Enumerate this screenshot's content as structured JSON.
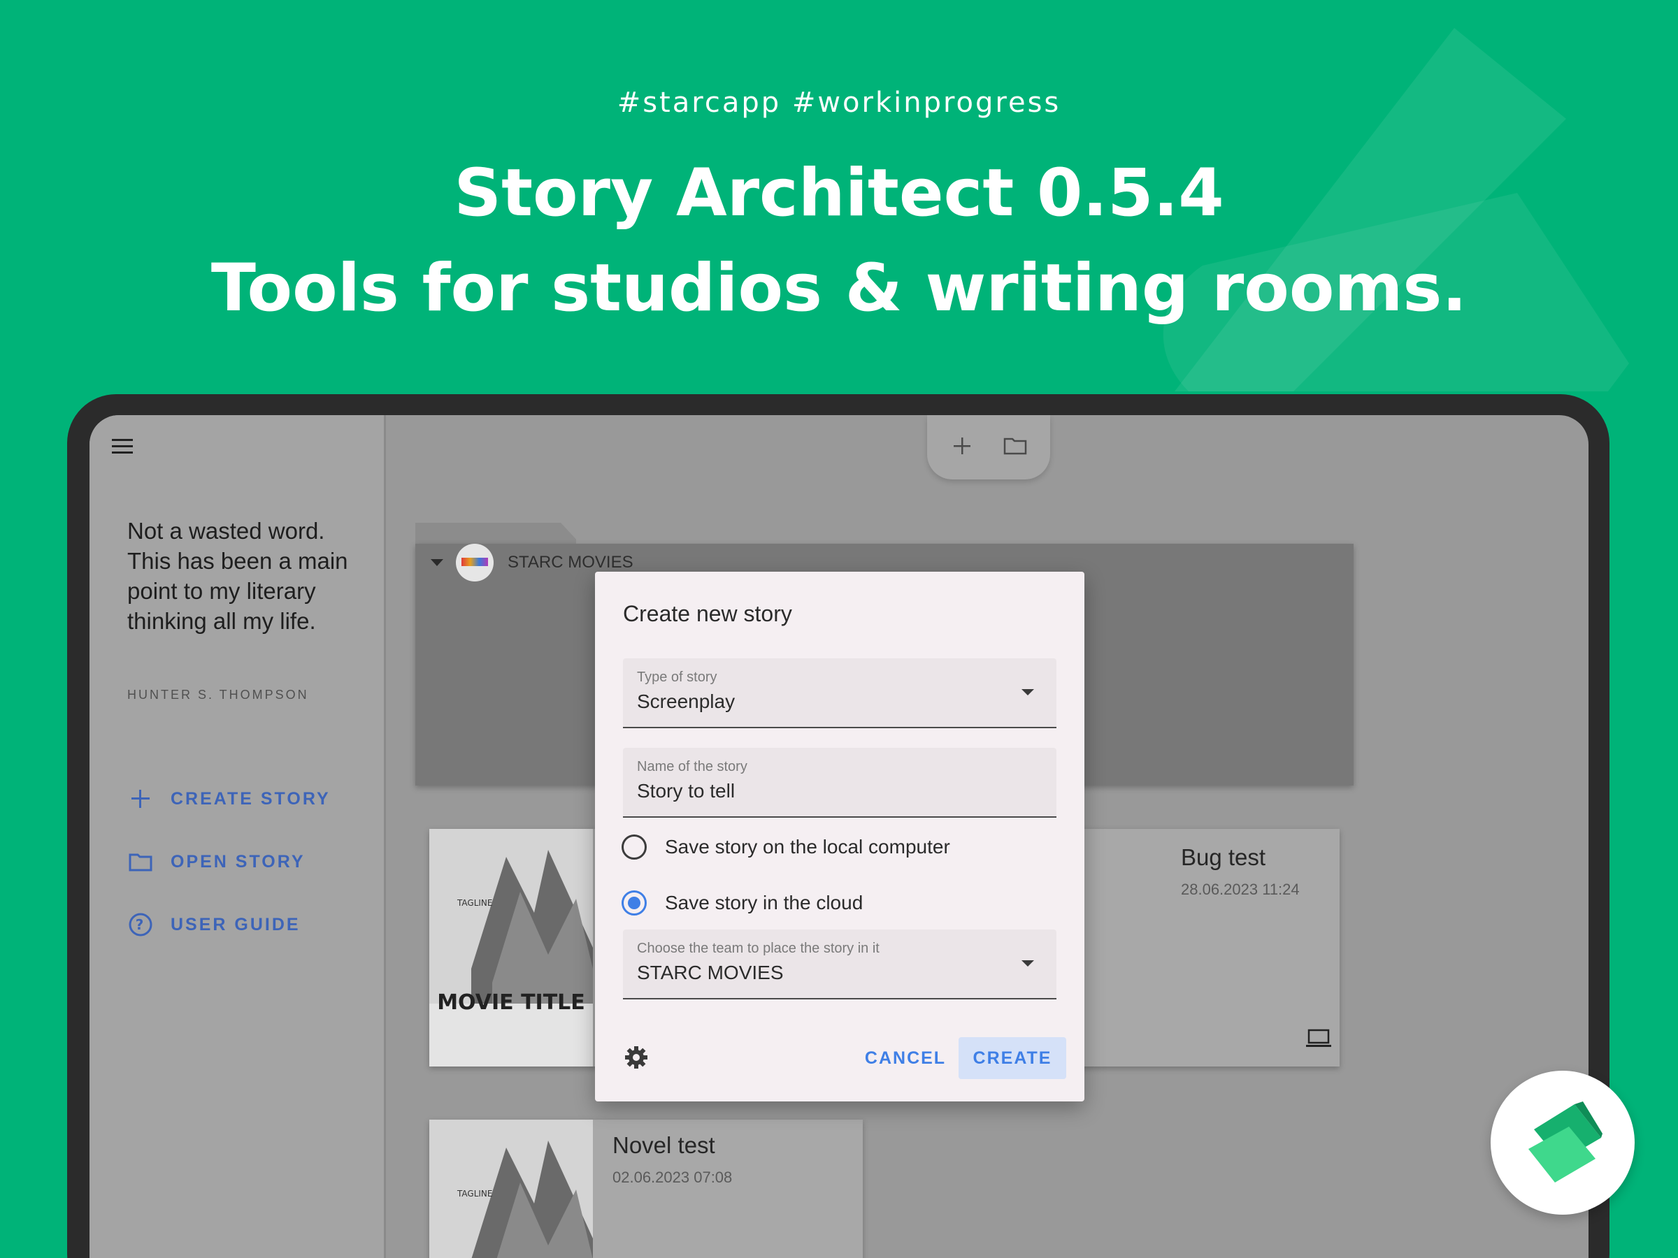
{
  "banner": {
    "hashtags": "#starcapp  #workinprogress",
    "headline_line1": "Story Architect 0.5.4",
    "headline_line2": "Tools for studios & writing rooms."
  },
  "sidebar": {
    "quote": "Not a wasted word. This has been a main point to my literary thinking all my life.",
    "quote_author": "HUNTER S. THOMPSON",
    "actions": [
      {
        "label": "CREATE STORY",
        "icon": "plus-icon"
      },
      {
        "label": "OPEN STORY",
        "icon": "folder-icon"
      },
      {
        "label": "USER GUIDE",
        "icon": "help-circle-icon"
      }
    ]
  },
  "toolbar": {
    "buttons": [
      "plus-icon",
      "folder-icon"
    ]
  },
  "team_folder": {
    "name": "STARC MOVIES"
  },
  "projects": [
    {
      "title": "Bug test",
      "date": "28.06.2023 11:24",
      "location_icon": "laptop-icon"
    },
    {
      "title": "Novel test",
      "date": "02.06.2023 07:08"
    }
  ],
  "poster": {
    "title": "MOVIE TITLE",
    "tagline": "TAGLINE"
  },
  "dialog": {
    "title": "Create new story",
    "type_field": {
      "label": "Type of story",
      "value": "Screenplay"
    },
    "name_field": {
      "label": "Name of the story",
      "value": "Story to tell"
    },
    "radio_local": {
      "label": "Save story on the local computer",
      "selected": false
    },
    "radio_cloud": {
      "label": "Save story in the cloud",
      "selected": true
    },
    "team_field": {
      "label": "Choose the team to place the story in it",
      "value": "STARC MOVIES"
    },
    "cancel_label": "CANCEL",
    "create_label": "CREATE"
  },
  "colors": {
    "background": "#00b378",
    "accent": "#3f7fe6",
    "sidebar_link": "#3d64b8",
    "dialog_bg": "#f5eff2"
  }
}
